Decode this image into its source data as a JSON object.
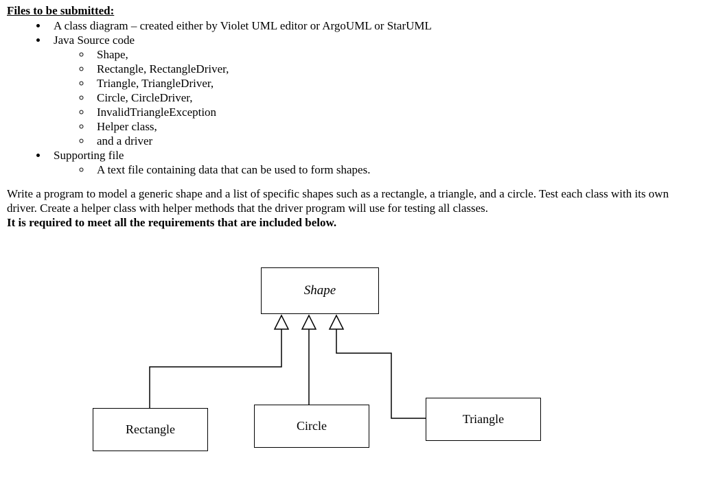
{
  "heading": "Files to be submitted:",
  "bullets": [
    "A class diagram – created either by Violet UML editor or ArgoUML or StarUML",
    "Java Source code"
  ],
  "java_items": [
    "Shape,",
    "Rectangle, RectangleDriver,",
    "Triangle, TriangleDriver,",
    "Circle, CircleDriver,",
    "InvalidTriangleException",
    "Helper class,",
    "and a driver"
  ],
  "bullets2": [
    "Supporting file"
  ],
  "supporting_items": [
    "A text file containing data that can be used to form shapes."
  ],
  "paragraph": "Write a program to model a generic shape and a list of specific shapes such as a rectangle, a triangle, and a circle. Test each class with its own driver. Create a helper class with helper methods that the driver program will use for testing all classes.",
  "bold_line": "It is required to meet all the requirements that are included below.",
  "diagram": {
    "parent": "Shape",
    "children": [
      "Rectangle",
      "Circle",
      "Triangle"
    ]
  }
}
